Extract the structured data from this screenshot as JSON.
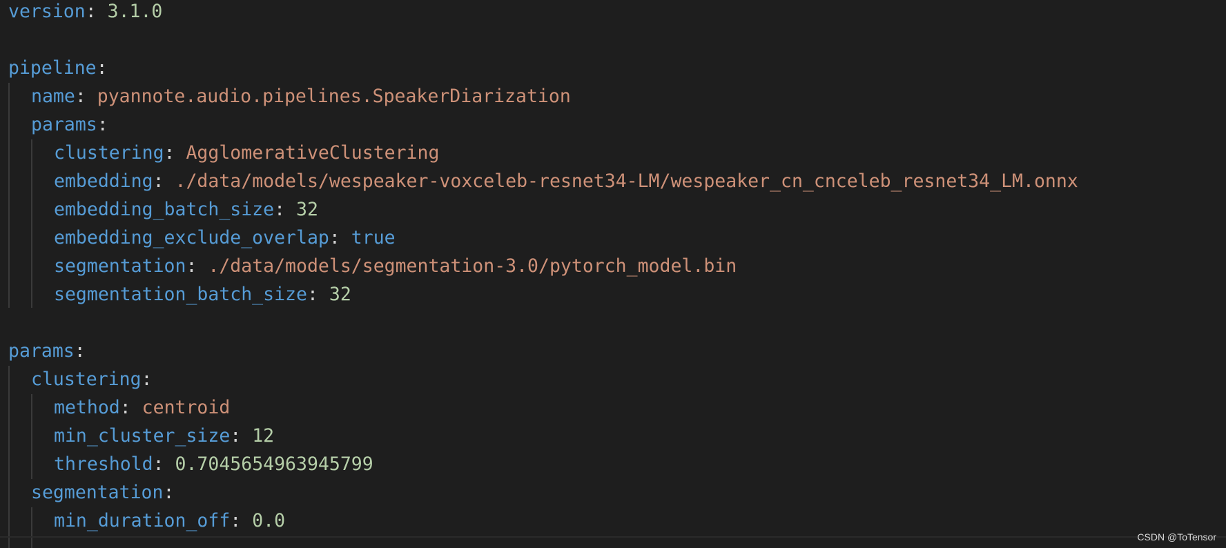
{
  "lines": [
    {
      "key": "version",
      "value": "3.1.0",
      "vtype": "num"
    },
    {
      "key": "pipeline",
      "value": "",
      "vtype": ""
    },
    {
      "key": "name",
      "value": "pyannote.audio.pipelines.SpeakerDiarization",
      "vtype": "str"
    },
    {
      "key": "params",
      "value": "",
      "vtype": ""
    },
    {
      "key": "clustering",
      "value": "AgglomerativeClustering",
      "vtype": "str"
    },
    {
      "key": "embedding",
      "value": "./data/models/wespeaker-voxceleb-resnet34-LM/wespeaker_cn_cnceleb_resnet34_LM.onnx",
      "vtype": "str"
    },
    {
      "key": "embedding_batch_size",
      "value": "32",
      "vtype": "num"
    },
    {
      "key": "embedding_exclude_overlap",
      "value": "true",
      "vtype": "bool"
    },
    {
      "key": "segmentation",
      "value": "./data/models/segmentation-3.0/pytorch_model.bin",
      "vtype": "str"
    },
    {
      "key": "segmentation_batch_size",
      "value": "32",
      "vtype": "num"
    },
    {
      "key": "params",
      "value": "",
      "vtype": ""
    },
    {
      "key": "clustering",
      "value": "",
      "vtype": ""
    },
    {
      "key": "method",
      "value": "centroid",
      "vtype": "str"
    },
    {
      "key": "min_cluster_size",
      "value": "12",
      "vtype": "num"
    },
    {
      "key": "threshold",
      "value": "0.7045654963945799",
      "vtype": "num"
    },
    {
      "key": "segmentation",
      "value": "",
      "vtype": ""
    },
    {
      "key": "min_duration_off",
      "value": "0.0",
      "vtype": "num"
    }
  ],
  "watermark": "CSDN @ToTensor",
  "colors": {
    "background": "#1e1e1e",
    "key": "#569cd6",
    "string": "#ce9178",
    "number": "#b5cea8",
    "punctuation": "#d4d4d4"
  }
}
